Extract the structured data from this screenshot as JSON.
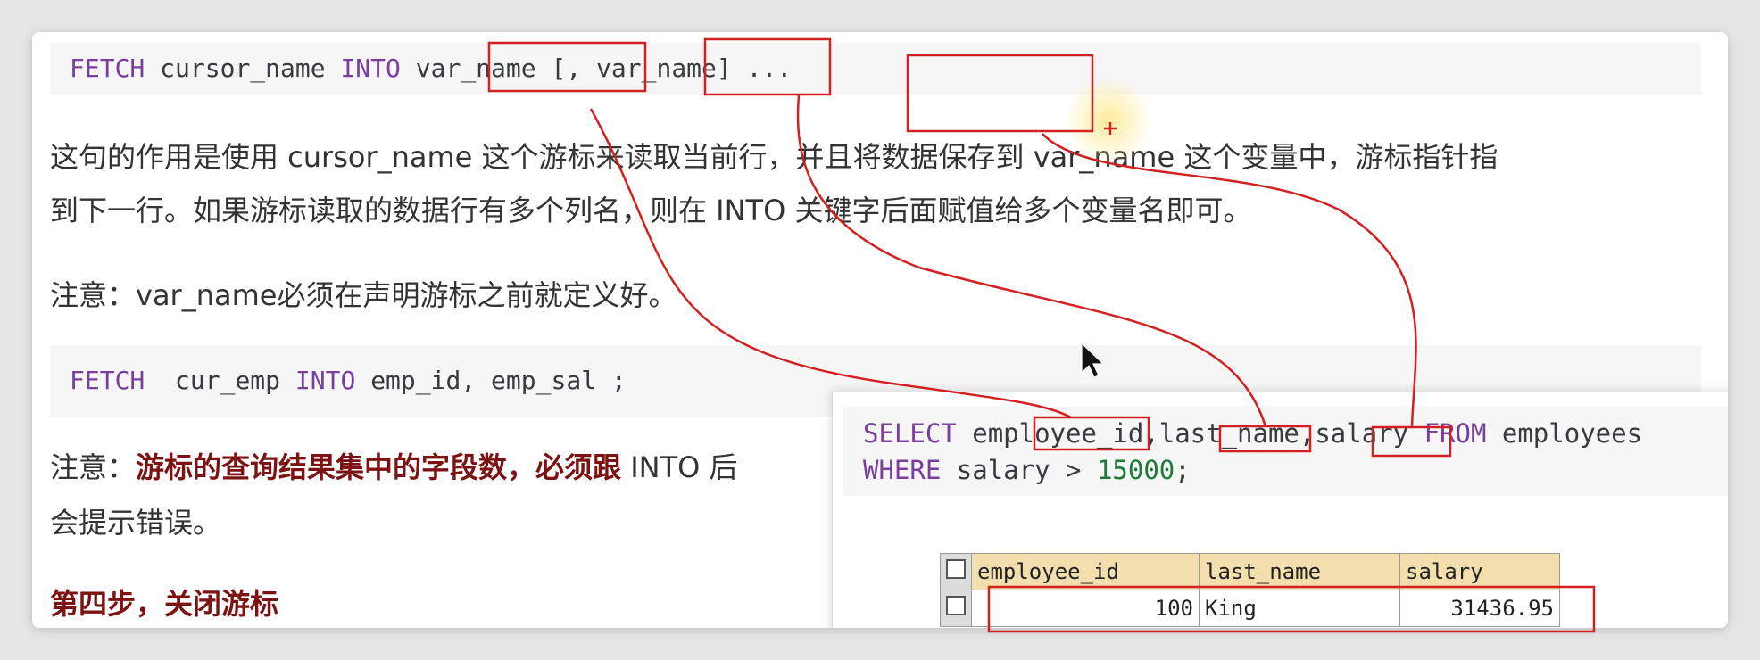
{
  "code1": {
    "kw1": "FETCH",
    "name": "cursor_name",
    "kw2": "INTO",
    "rest": "var_name [, var_name] ..."
  },
  "para1": {
    "line1": "这句的作用是使用 cursor_name 这个游标来读取当前行，并且将数据保存到 var_name 这个变量中，游标指针指",
    "line2": "到下一行。如果游标读取的数据行有多个列名，则在 INTO 关键字后面赋值给多个变量名即可。"
  },
  "para2": "注意：var_name必须在声明游标之前就定义好。",
  "code2": {
    "kw1": "FETCH",
    "name": "cur_emp",
    "kw2": "INTO",
    "rest": "emp_id, emp_sal ;"
  },
  "para3": {
    "prefix": "注意：",
    "bold": "游标的查询结果集中的字段数，必须跟",
    "tail": " INTO 后",
    "line2": "会提示错误。"
  },
  "heading": "第四步，关闭游标",
  "popup": {
    "sql_kw1": "SELECT",
    "sql_cols": "employee_id,last_name,salary",
    "sql_kw2": "FROM",
    "sql_table": "employees",
    "sql_kw3": "WHERE",
    "sql_cond": "salary >",
    "sql_num": "15000",
    "sql_end": ";",
    "columns": [
      "employee_id",
      "last_name",
      "salary"
    ],
    "rows": [
      [
        "100",
        "King",
        "31436.95"
      ]
    ]
  },
  "colors": {
    "annotation": "#d42020",
    "keyword": "#7a3e9d",
    "emphasis": "#7c1212"
  }
}
